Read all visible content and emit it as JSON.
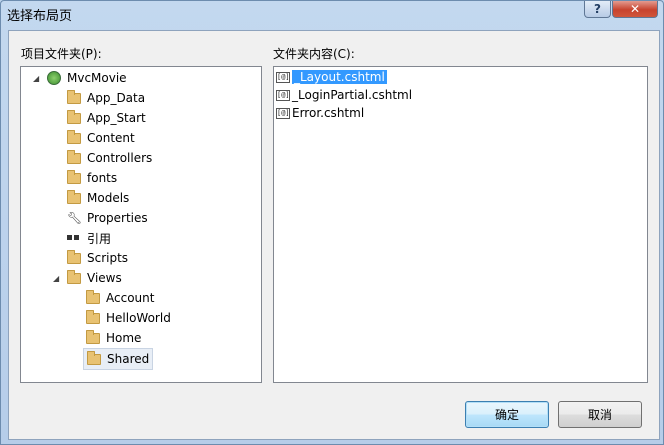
{
  "window": {
    "title": "选择布局页",
    "help_glyph": "?",
    "close_glyph": "✕"
  },
  "left_panel": {
    "label": "项目文件夹(P):",
    "root": "MvcMovie",
    "items": [
      {
        "label": "App_Data",
        "icon": "folder-icon"
      },
      {
        "label": "App_Start",
        "icon": "folder-icon"
      },
      {
        "label": "Content",
        "icon": "folder-icon"
      },
      {
        "label": "Controllers",
        "icon": "folder-icon"
      },
      {
        "label": "fonts",
        "icon": "folder-icon"
      },
      {
        "label": "Models",
        "icon": "folder-icon"
      },
      {
        "label": "Properties",
        "icon": "wrench-icon"
      },
      {
        "label": "引用",
        "icon": "references-icon"
      },
      {
        "label": "Scripts",
        "icon": "folder-icon"
      },
      {
        "label": "Views",
        "icon": "folder-icon",
        "expanded": true
      }
    ],
    "views_children": [
      {
        "label": "Account"
      },
      {
        "label": "HelloWorld"
      },
      {
        "label": "Home"
      },
      {
        "label": "Shared",
        "selected": true
      }
    ],
    "expanded_glyph": "◢"
  },
  "right_panel": {
    "label": "文件夹内容(C):",
    "file_icon_text": "[@]",
    "files": [
      {
        "name": "_Layout.cshtml",
        "selected": true
      },
      {
        "name": "_LoginPartial.cshtml"
      },
      {
        "name": "Error.cshtml"
      }
    ]
  },
  "buttons": {
    "ok": "确定",
    "cancel": "取消"
  },
  "colors": {
    "selection": "#3399ff",
    "client_bg": "#f0f0f0"
  }
}
